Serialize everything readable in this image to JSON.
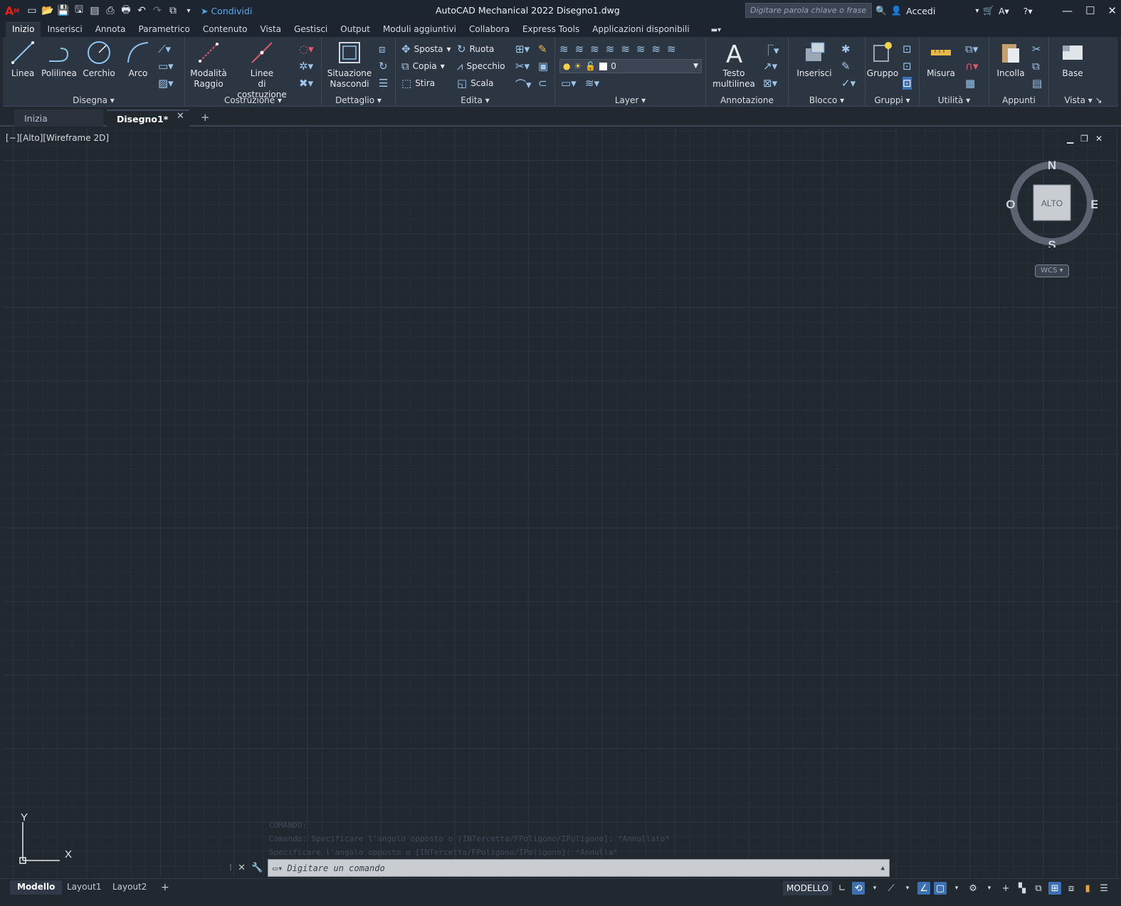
{
  "titlebar": {
    "app_title": "AutoCAD Mechanical 2022    Disegno1.dwg",
    "share_label": "Condividi",
    "search_placeholder": "Digitare parola chiave o frase",
    "signin_label": "Accedi"
  },
  "menu_tabs": [
    "Inizio",
    "Inserisci",
    "Annota",
    "Parametrico",
    "Contenuto",
    "Vista",
    "Gestisci",
    "Output",
    "Moduli aggiuntivi",
    "Collabora",
    "Express Tools",
    "Applicazioni disponibili"
  ],
  "ribbon": {
    "disegna": {
      "title": "Disegna",
      "linea": "Linea",
      "polilinea": "Polilinea",
      "cerchio": "Cerchio",
      "arco": "Arco"
    },
    "costruzione": {
      "title": "Costruzione",
      "modalita": "Modalità\nRaggio",
      "linee": "Linee\ndi costruzione"
    },
    "dettaglio": {
      "title": "Dettaglio",
      "situazione": "Situazione\nNascondi"
    },
    "edita": {
      "title": "Edita",
      "sposta": "Sposta",
      "copia": "Copia",
      "stira": "Stira",
      "ruota": "Ruota",
      "specchio": "Specchio",
      "scala": "Scala"
    },
    "layer": {
      "title": "Layer",
      "current_layer": "0"
    },
    "annotazione": {
      "title": "Annotazione",
      "testo": "Testo\nmultilinea"
    },
    "blocco": {
      "title": "Blocco",
      "inserisci": "Inserisci"
    },
    "gruppi": {
      "title": "Gruppi",
      "gruppo": "Gruppo"
    },
    "utilita": {
      "title": "Utilità",
      "misura": "Misura"
    },
    "appunti": {
      "title": "Appunti",
      "incolla": "Incolla"
    },
    "vista": {
      "title": "Vista",
      "base": "Base"
    }
  },
  "doc_tabs": {
    "start": "Inizia",
    "drawing": "Disegno1*"
  },
  "viewport": {
    "label": "[−][Alto][Wireframe 2D]",
    "viewcube": {
      "face": "ALTO",
      "north": "N",
      "south": "S",
      "east": "E",
      "west": "O",
      "wcs": "WCS"
    },
    "ucs": {
      "x": "X",
      "y": "Y"
    }
  },
  "command": {
    "history": [
      "COMANDO:",
      "Comando: Specificare l'angolo opposto o [INTercetta/FPoligono/IPoligono]: *Annullato*",
      "Specificare l'angolo opposto o [INTercetta/FPoligono/IPoligono]: *Annulla*"
    ],
    "placeholder": "Digitare un comando"
  },
  "layout_tabs": [
    "Modello",
    "Layout1",
    "Layout2"
  ],
  "status": {
    "model_label": "MODELLO"
  }
}
